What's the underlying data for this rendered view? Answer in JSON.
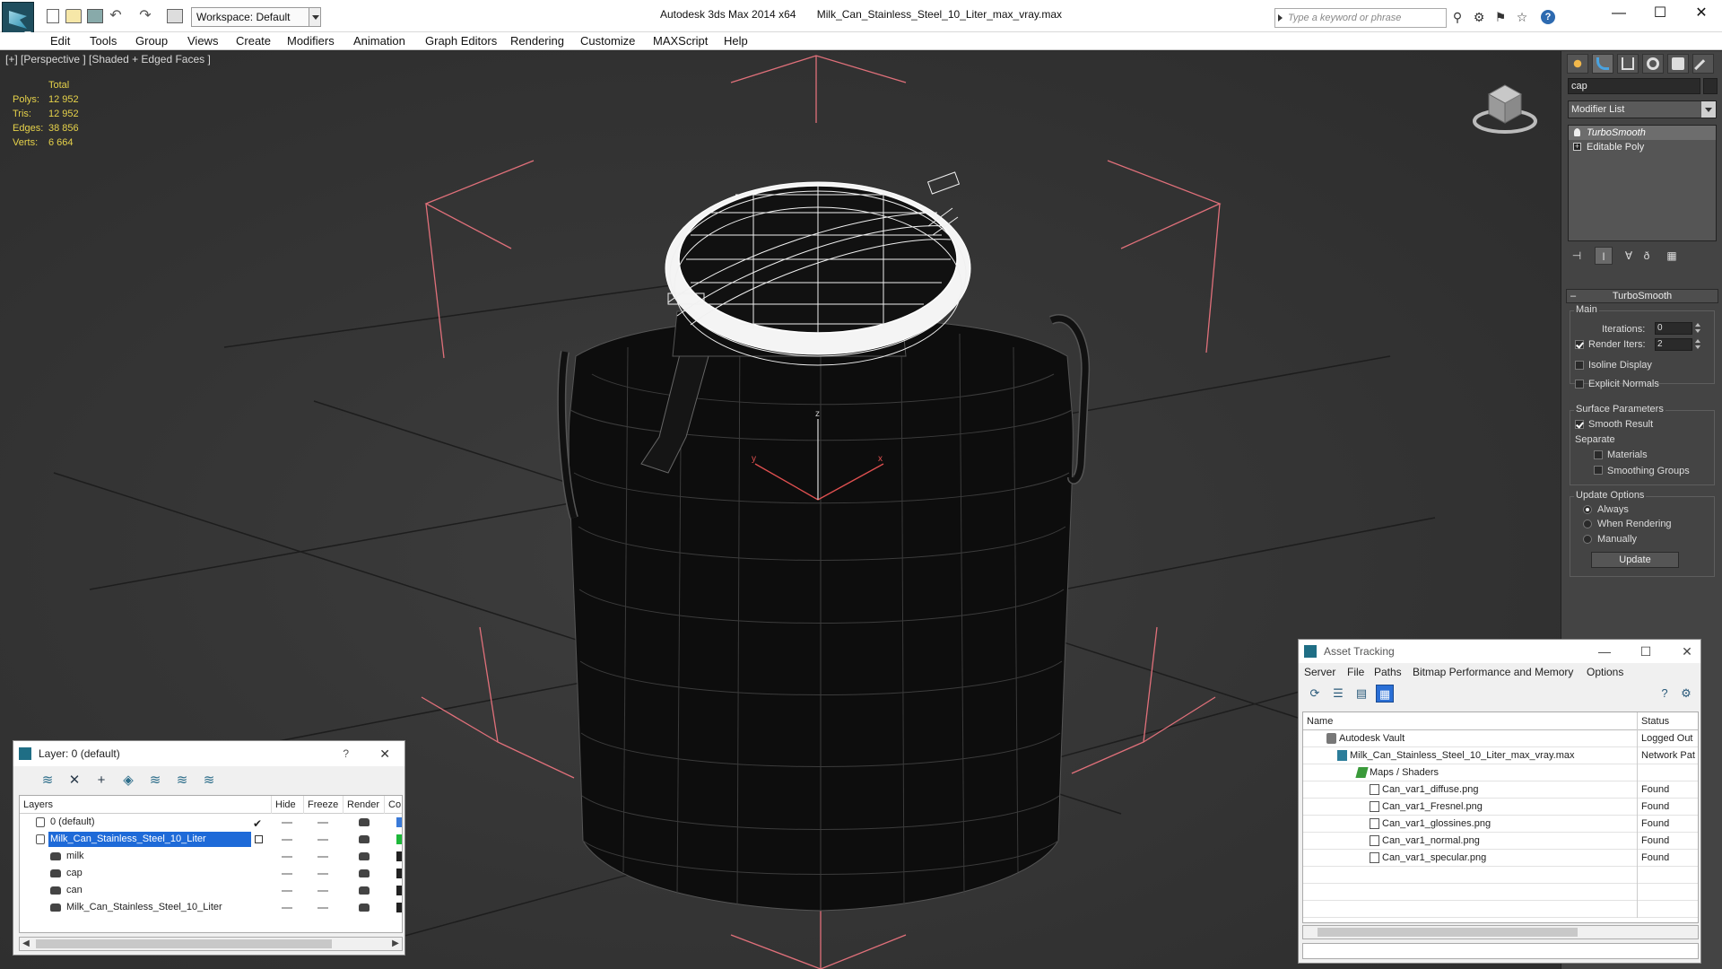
{
  "titlebar": {
    "workspace": "Workspace: Default",
    "app": "Autodesk 3ds Max  2014 x64",
    "file": "Milk_Can_Stainless_Steel_10_Liter_max_vray.max",
    "search_placeholder": "Type a keyword or phrase"
  },
  "menu": [
    "Edit",
    "Tools",
    "Group",
    "Views",
    "Create",
    "Modifiers",
    "Animation",
    "Graph Editors",
    "Rendering",
    "Customize",
    "MAXScript",
    "Help"
  ],
  "viewport": {
    "label": "[+] [Perspective ] [Shaded + Edged Faces ]",
    "stats": {
      "header": "Total",
      "rows": [
        {
          "k": "Polys:",
          "v": "12 952"
        },
        {
          "k": "Tris:",
          "v": "12 952"
        },
        {
          "k": "Edges:",
          "v": "38 856"
        },
        {
          "k": "Verts:",
          "v": "6 664"
        }
      ]
    },
    "axis_x": "x",
    "axis_y": "y",
    "axis_z": "z"
  },
  "command_panel": {
    "object_name": "cap",
    "modifier_list": "Modifier List",
    "stack": [
      "TurboSmooth",
      "Editable Poly"
    ],
    "rollout_title": "TurboSmooth",
    "main_group": "Main",
    "iterations_label": "Iterations:",
    "iterations_value": "0",
    "render_iters_label": "Render Iters:",
    "render_iters_value": "2",
    "isoline": "Isoline Display",
    "explicit_normals": "Explicit Normals",
    "surface_group": "Surface Parameters",
    "smooth_result": "Smooth Result",
    "separate": "Separate",
    "materials": "Materials",
    "smoothing_groups": "Smoothing Groups",
    "update_group": "Update Options",
    "always": "Always",
    "when_rendering": "When Rendering",
    "manually": "Manually",
    "update_button": "Update"
  },
  "layer_dialog": {
    "title": "Layer: 0 (default)",
    "help": "?",
    "columns": [
      "Layers",
      "Hide",
      "Freeze",
      "Render",
      "Co"
    ],
    "rows": [
      {
        "name": "0 (default)",
        "color": "#3a7ad8"
      },
      {
        "name": "Milk_Can_Stainless_Steel_10_Liter",
        "color": "#1eb83a"
      },
      {
        "name": "milk",
        "color": "#222222"
      },
      {
        "name": "cap",
        "color": "#222222"
      },
      {
        "name": "can",
        "color": "#222222"
      },
      {
        "name": "Milk_Can_Stainless_Steel_10_Liter",
        "color": "#222222"
      }
    ]
  },
  "asset_tracking": {
    "title": "Asset Tracking",
    "menu": [
      "Server",
      "File",
      "Paths",
      "Bitmap Performance and Memory",
      "Options"
    ],
    "col_name": "Name",
    "col_status": "Status",
    "rows": [
      {
        "name": "Autodesk Vault",
        "status": "Logged Out",
        "icon": "vault-icon"
      },
      {
        "name": "Milk_Can_Stainless_Steel_10_Liter_max_vray.max",
        "status": "Network Pat",
        "icon": "max-file-icon"
      },
      {
        "name": "Maps / Shaders",
        "status": "",
        "icon": "maps-icon"
      },
      {
        "name": "Can_var1_diffuse.png",
        "status": "Found",
        "icon": "png-icon"
      },
      {
        "name": "Can_var1_Fresnel.png",
        "status": "Found",
        "icon": "png-icon"
      },
      {
        "name": "Can_var1_glossines.png",
        "status": "Found",
        "icon": "png-icon"
      },
      {
        "name": "Can_var1_normal.png",
        "status": "Found",
        "icon": "png-icon"
      },
      {
        "name": "Can_var1_specular.png",
        "status": "Found",
        "icon": "png-icon"
      }
    ]
  }
}
